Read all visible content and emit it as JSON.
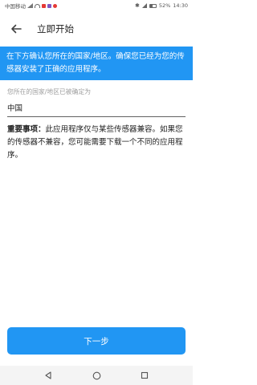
{
  "status_bar": {
    "carrier": "中国移动",
    "battery": "52%",
    "time": "14:30",
    "icons": [
      "sim-signal-icon",
      "wifi-icon",
      "app-notification-icon",
      "bluetooth-icon",
      "signal-icon",
      "battery-icon"
    ]
  },
  "app_bar": {
    "title": "立即开始",
    "back_icon": "arrow-left-icon"
  },
  "banner": {
    "text": "在下方确认您所在的国家/地区。确保您已经为您的传感器安装了正确的应用程序。",
    "background_color": "#2196F3"
  },
  "region_field": {
    "label": "您所在的国家/地区已被确定为",
    "value": "中国"
  },
  "notice": {
    "heading": "重要事项：",
    "body": "此应用程序仅与某些传感器兼容。如果您的传感器不兼容，您可能需要下载一个不同的应用程序。"
  },
  "next_button": {
    "label": "下一步",
    "color": "#2196F3"
  },
  "nav_bar": {
    "buttons": [
      "back-triangle-icon",
      "home-circle-icon",
      "recents-square-icon"
    ]
  }
}
